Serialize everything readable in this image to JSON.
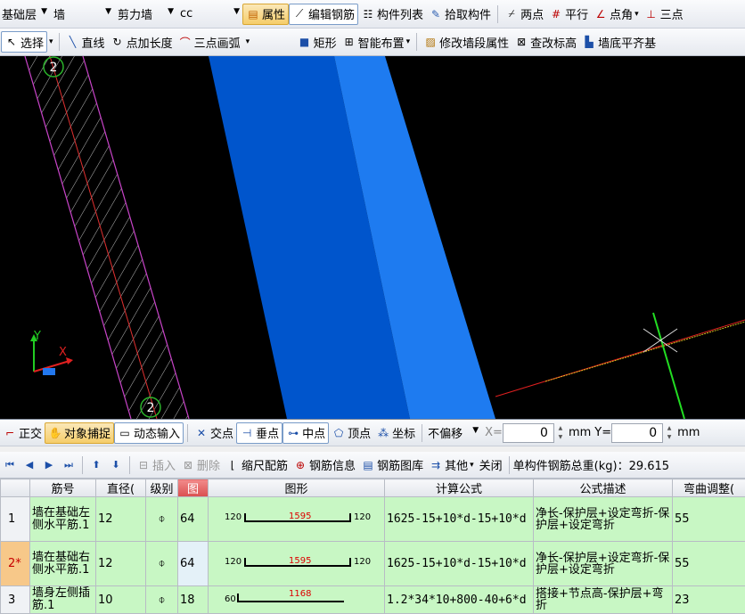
{
  "toolbar1": {
    "floor": "基础层",
    "category": "墙",
    "type": "剪力墙",
    "member": "cc",
    "buttons": [
      "属性",
      "编辑钢筋",
      "构件列表",
      "拾取构件",
      "两点",
      "平行",
      "点角",
      "三点"
    ]
  },
  "toolbar2": {
    "select": "选择",
    "line": "直线",
    "point_length": "点加长度",
    "arc": "三点画弧",
    "rect": "矩形",
    "smart": "智能布置",
    "modify_wall": "修改墙段属性",
    "change_elev": "查改标高",
    "wall_bottom": "墙底平齐基"
  },
  "canvas": {
    "axis_top": "2",
    "axis_bottom": "2",
    "x_label": "X",
    "y_label": "Y",
    "colors": {
      "background": "#000000",
      "wall_dark": "#0055cc",
      "wall_light": "#1e7bf0",
      "hatch": "#c944c9"
    }
  },
  "toolbar3": {
    "ortho": "正交",
    "snap": "对象捕捉",
    "dynamic": "动态输入",
    "intersection": "交点",
    "perpendicular": "垂点",
    "midpoint": "中点",
    "vertex": "顶点",
    "coordinate": "坐标",
    "offset": "不偏移",
    "x_label": "X=",
    "x_value": "0",
    "x_unit": "mm",
    "y_label": "Y=",
    "y_value": "0",
    "y_unit": "mm"
  },
  "toolbar4": {
    "insert": "插入",
    "delete": "删除",
    "scale_rebar": "缩尺配筋",
    "rebar_info": "钢筋信息",
    "rebar_lib": "钢筋图库",
    "other": "其他",
    "close": "关闭",
    "total_label": "单构件钢筋总重(kg)：29.615"
  },
  "grid": {
    "headers": [
      "",
      "筋号",
      "直径(",
      "级别",
      "图",
      "图形",
      "计算公式",
      "公式描述",
      "弯曲调整("
    ],
    "rows": [
      {
        "no": "1",
        "name": "墙在基础左侧水平筋.1",
        "dia": "12",
        "grade": "⌽",
        "fig": "64",
        "left": "120",
        "mid": "1595",
        "right": "120",
        "formula": "1625-15+10*d-15+10*d",
        "desc": "净长-保护层+设定弯折-保护层+设定弯折",
        "bend": "55"
      },
      {
        "no": "2*",
        "name": "墙在基础右侧水平筋.1",
        "dia": "12",
        "grade": "⌽",
        "fig": "64",
        "left": "120",
        "mid": "1595",
        "right": "120",
        "formula": "1625-15+10*d-15+10*d",
        "desc": "净长-保护层+设定弯折-保护层+设定弯折",
        "bend": "55"
      },
      {
        "no": "3",
        "name": "墙身左侧插筋.1",
        "dia": "10",
        "grade": "⌽",
        "fig": "18",
        "left": "60",
        "mid": "1168",
        "right": "",
        "formula": "1.2*34*10+800-40+6*d",
        "desc": "搭接+节点高-保护层+弯折",
        "bend": "23"
      }
    ]
  }
}
